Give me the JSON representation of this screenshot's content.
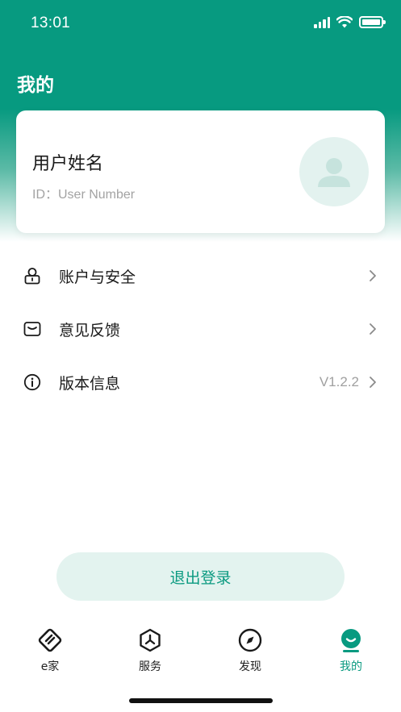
{
  "status_bar": {
    "time": "13:01"
  },
  "header": {
    "title": "我的"
  },
  "profile": {
    "name": "用户姓名",
    "id_text": "ID：User Number"
  },
  "menu": [
    {
      "label": "账户与安全",
      "icon": "lock-icon",
      "value": ""
    },
    {
      "label": "意见反馈",
      "icon": "mail-icon",
      "value": ""
    },
    {
      "label": "版本信息",
      "icon": "info-icon",
      "value": "V1.2.2"
    }
  ],
  "logout": {
    "label": "退出登录"
  },
  "tabbar": {
    "tabs": [
      {
        "label": "e家",
        "icon": "e-home-icon"
      },
      {
        "label": "服务",
        "icon": "service-icon"
      },
      {
        "label": "发现",
        "icon": "compass-icon"
      },
      {
        "label": "我的",
        "icon": "profile-tab-icon"
      }
    ],
    "active_index": 3
  },
  "colors": {
    "brand": "#079a80",
    "accent_light": "#e3f3ef",
    "text_primary": "#1a1a1a",
    "text_secondary": "#a3a3a3"
  }
}
